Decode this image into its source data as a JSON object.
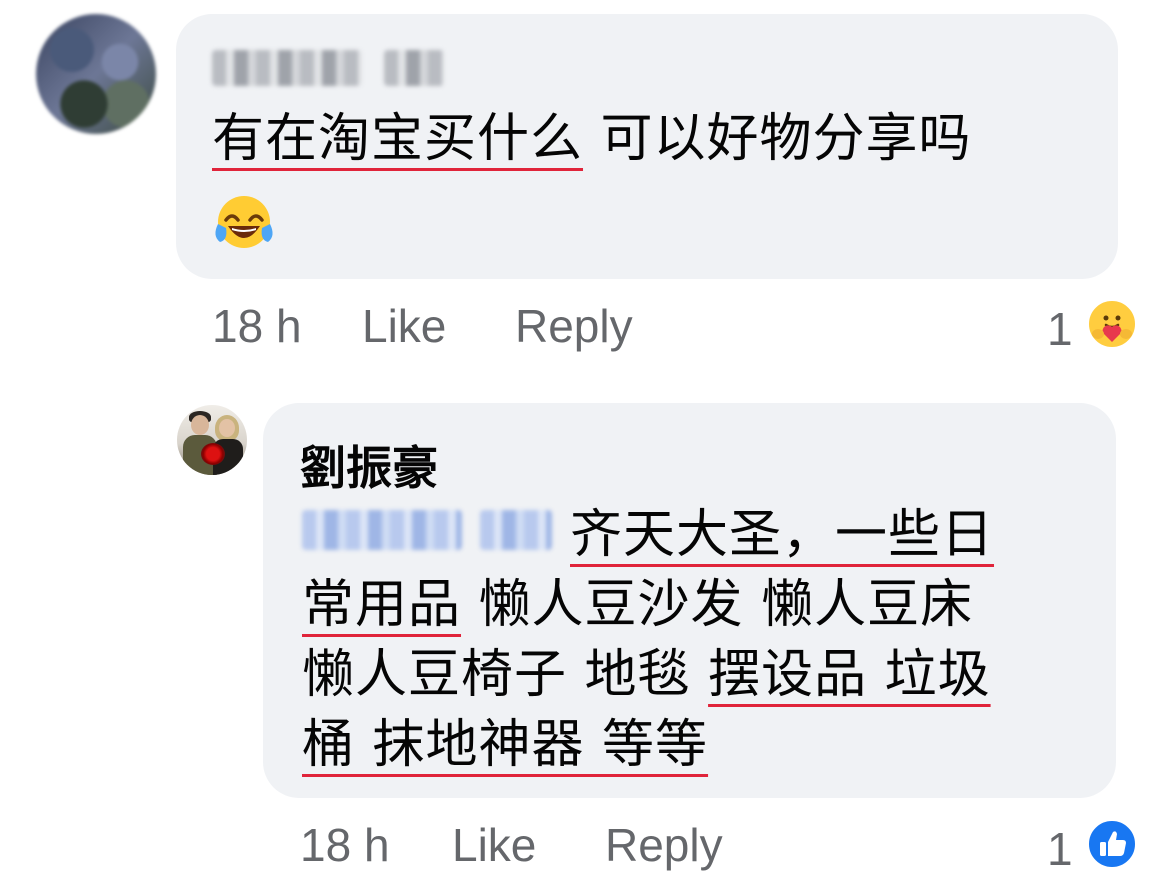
{
  "comment1": {
    "author_redacted": true,
    "text": "有在淘宝买什么",
    "text_tail": " 可以好物分享吗",
    "emoji": "face-with-tears-of-joy",
    "time": "18 h",
    "like_label": "Like",
    "reply_label": "Reply",
    "reaction_count": "1",
    "reaction_icon": "care-reaction-icon"
  },
  "comment2": {
    "author": "劉振豪",
    "mention_redacted": true,
    "line1": "齐天大圣，一些日",
    "line2_u": "常用品",
    "line2_rest": " 懒人豆沙发 懒人豆床",
    "line3_a": "懒人豆椅子 地毯 ",
    "line3_u": "摆设品 垃圾",
    "line4": "桶 抹地神器 等等",
    "time": "18 h",
    "like_label": "Like",
    "reply_label": "Reply",
    "reaction_count": "1",
    "reaction_icon": "like-reaction-icon"
  },
  "colors": {
    "bubble": "#f0f2f5",
    "meta_text": "#65676b",
    "spell_underline": "#e0243a",
    "like_blue": "#1877f2"
  }
}
